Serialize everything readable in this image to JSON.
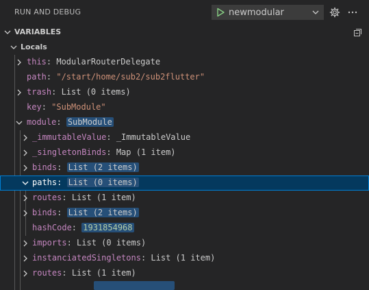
{
  "header": {
    "title": "RUN AND DEBUG",
    "configuration": "newmodular"
  },
  "variables_section": {
    "title": "VARIABLES"
  },
  "tree": {
    "scope": "Locals",
    "rows": [
      {
        "name": "this",
        "value": "ModularRouterDelegate"
      },
      {
        "name": "path",
        "value": "\"/start/home/sub2/sub2flutter\""
      },
      {
        "name": "trash",
        "value": "List (0 items)"
      },
      {
        "name": "key",
        "value": "\"SubModule\""
      },
      {
        "name": "module",
        "value": "SubModule"
      },
      {
        "name": "_immutableValue",
        "value": "_ImmutableValue"
      },
      {
        "name": "_singletonBinds",
        "value": "Map (1 item)"
      },
      {
        "name": "binds",
        "value": "List (2 items)"
      },
      {
        "name": "paths",
        "value": "List (0 items)"
      },
      {
        "name": "routes",
        "value": "List (1 item)"
      },
      {
        "name": "binds",
        "value": "List (2 items)"
      },
      {
        "name": "hashCode",
        "value": "1931854968"
      },
      {
        "name": "imports",
        "value": "List (0 items)"
      },
      {
        "name": "instanciatedSingletons",
        "value": "List (1 item)"
      },
      {
        "name": "routes",
        "value": "List (1 item)"
      }
    ]
  },
  "colors": {
    "background": "#252526",
    "selection": "#04395e",
    "focus_border": "#007fd4",
    "variable_name": "#c586c0",
    "string_value": "#ce9178",
    "number_value": "#b5cea8",
    "changed_value_bg": "#264f78",
    "play_green": "#89d185"
  }
}
